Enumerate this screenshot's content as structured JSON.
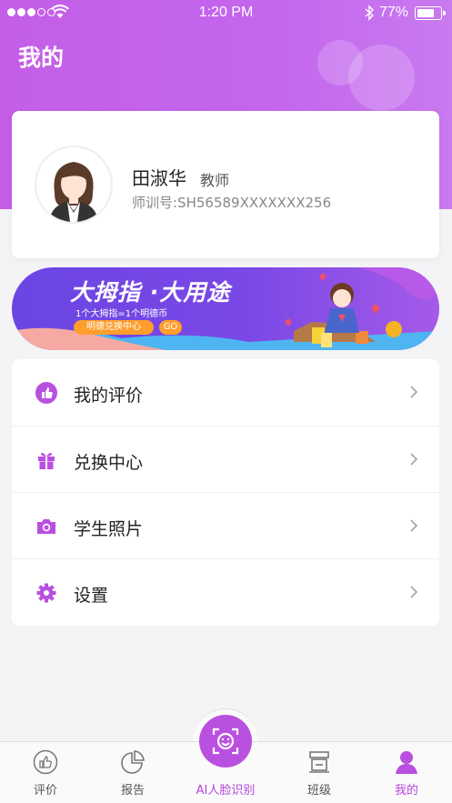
{
  "status_bar": {
    "time": "1:20 PM",
    "battery_percent": "77%",
    "battery_level": 0.77
  },
  "header": {
    "title": "我的"
  },
  "profile": {
    "name": "田淑华",
    "role": "教师",
    "teacher_id": "师训号:SH56589XXXXXXX256"
  },
  "banner": {
    "title": "大拇指 ·大用途",
    "subtitle": "1个大拇指=1个明德币",
    "pill_label": "明德兑换中心",
    "go_label": "GO"
  },
  "menu": {
    "items": [
      {
        "label": "我的评价",
        "icon": "thumbs-up-icon"
      },
      {
        "label": "兑换中心",
        "icon": "gift-icon"
      },
      {
        "label": "学生照片",
        "icon": "camera-icon"
      },
      {
        "label": "设置",
        "icon": "gear-icon"
      }
    ]
  },
  "tabbar": {
    "tabs": [
      {
        "label": "评价",
        "icon": "thumbs-up-icon"
      },
      {
        "label": "报告",
        "icon": "pie-chart-icon"
      },
      {
        "label": "AI人脸识别",
        "icon": "face-scan-icon"
      },
      {
        "label": "班级",
        "icon": "class-icon"
      },
      {
        "label": "我的",
        "icon": "user-icon"
      }
    ],
    "active": "我的"
  },
  "colors": {
    "accent": "#b950e0",
    "header_gradient_start": "#c45ee6",
    "banner_gradient_start": "#6b45e4",
    "pill": "#ff9e2c"
  }
}
